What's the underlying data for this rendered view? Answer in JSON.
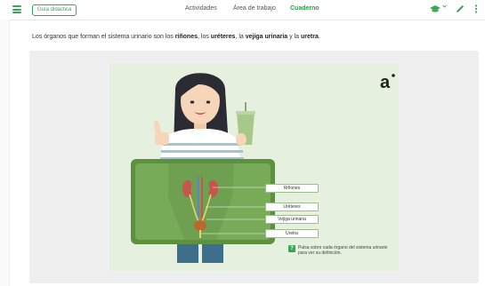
{
  "topbar": {
    "guide_label": "Guía didáctica",
    "tabs": [
      {
        "label": "Actividades"
      },
      {
        "label": "Área de trabajo"
      },
      {
        "label": "Cuaderno"
      }
    ]
  },
  "prompt": {
    "part1": "Los órganos que forman el sistema urinario son los ",
    "kidneys": "riñones",
    "part2": ", los ",
    "ureters": "uréteres",
    "part3": ", la ",
    "bladder": "vejiga urinaria",
    "part4": " y la ",
    "urethra": "uretra",
    "part5": "."
  },
  "illustration": {
    "labels": {
      "kidneys": "Riñones",
      "ureters": "Uréteres",
      "bladder": "Vejiga urinaria",
      "urethra": "Uretra"
    },
    "hint_badge": "?",
    "hint": "Pulsa sobre cada órgano del sistema urinario para ver su definición.",
    "logo": "a"
  },
  "colors": {
    "accent": "#3aa655",
    "stage_bg": "#e6f0df",
    "board": "#5d9140",
    "hair": "#2b2b33"
  }
}
